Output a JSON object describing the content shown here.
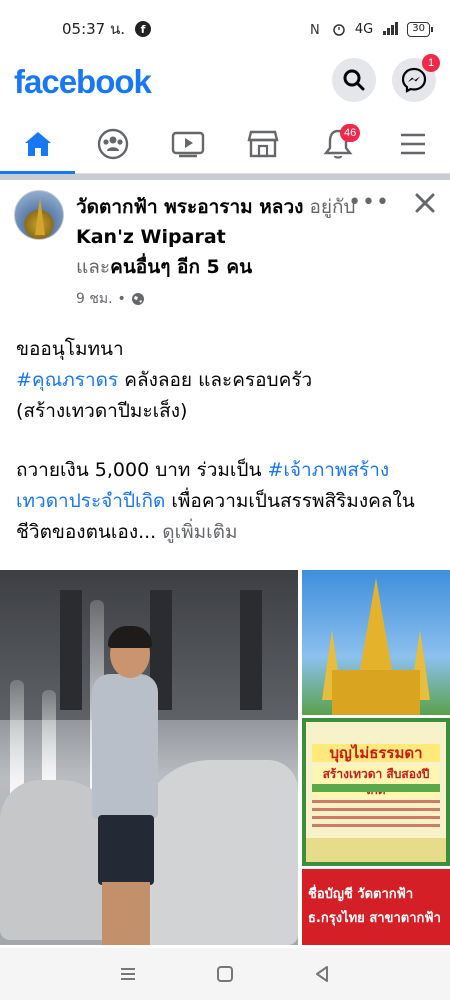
{
  "status_bar": {
    "time": "05:37 น.",
    "app_icon": "f",
    "signal_text": "4G",
    "battery": "30"
  },
  "header": {
    "logo": "facebook",
    "messenger_badge": "1"
  },
  "tabs": [
    {
      "name": "home",
      "active": true
    },
    {
      "name": "groups",
      "active": false
    },
    {
      "name": "watch",
      "active": false
    },
    {
      "name": "marketplace",
      "active": false
    },
    {
      "name": "notifications",
      "active": false,
      "badge": "46"
    },
    {
      "name": "menu",
      "active": false
    }
  ],
  "post": {
    "author": "วัดตากฟ้า พระอาราม หลวง",
    "with_text": "อยู่กับ",
    "tagged": "Kan'z Wiparat",
    "and_text": "และ",
    "others": "คนอื่นๆ อีก 5 คน",
    "time": "9 ชม.",
    "separator": "•",
    "line1": "ขออนุโมทนา",
    "hashtag1": "#คุณภราดร",
    "line2_rest": " คลังลอย และครอบครัว",
    "line3": "(สร้างเทวดาปีมะเส็ง)",
    "line4_start": "ถวายเงิน 5,000 บาท ร่วมเป็น ",
    "hashtag2": "#เจ้าภาพสร้างเทวดาประจำปีเกิด",
    "line5_rest": "  เพื่อความเป็นสรรพสิริมงคลในชีวิตของตนเอง...",
    "see_more": " ดูเพิ่มเติม"
  },
  "photos": {
    "mid_title": "บุญไม่ธรรมดา",
    "mid_sub": "สร้างเทวดา สืบสองปีเกิด",
    "bottom_line1": "ชื่อบัญชี วัดตากฟ้า",
    "bottom_line2": "ธ.กรุงไทย สาขาตากฟ้า"
  },
  "colors": {
    "brand": "#1877f2",
    "badge": "#f02849",
    "muted": "#65676b"
  }
}
